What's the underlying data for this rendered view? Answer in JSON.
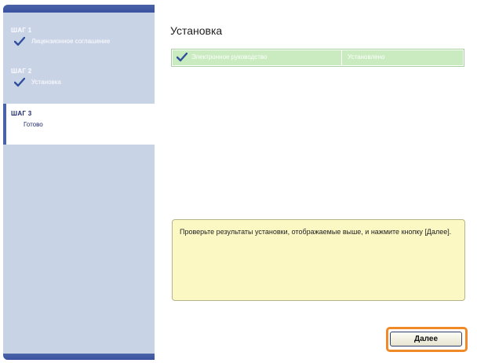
{
  "sidebar": {
    "steps": [
      {
        "label": "ШАГ 1",
        "text": "Лицензионное соглашение",
        "done": true
      },
      {
        "label": "ШАГ 2",
        "text": "Установка",
        "done": true
      },
      {
        "label": "ШАГ 3",
        "text": "Готово",
        "done": false
      }
    ]
  },
  "main": {
    "title": "Установка",
    "results": [
      {
        "item": "Электронное руководство",
        "status": "Установлено"
      }
    ],
    "message": "Проверьте результаты установки, отображаемые выше, и нажмите кнопку [Далее].",
    "next_label": "Далее"
  },
  "colors": {
    "sidebar_bg": "#c9d3e6",
    "accent": "#3a52a0",
    "row_bg": "#c9ebbf",
    "message_bg": "#fbf8c4",
    "highlight": "#f08a26"
  },
  "icons": {
    "step_done": "checkmark-icon",
    "row_status": "checkmark-icon"
  }
}
